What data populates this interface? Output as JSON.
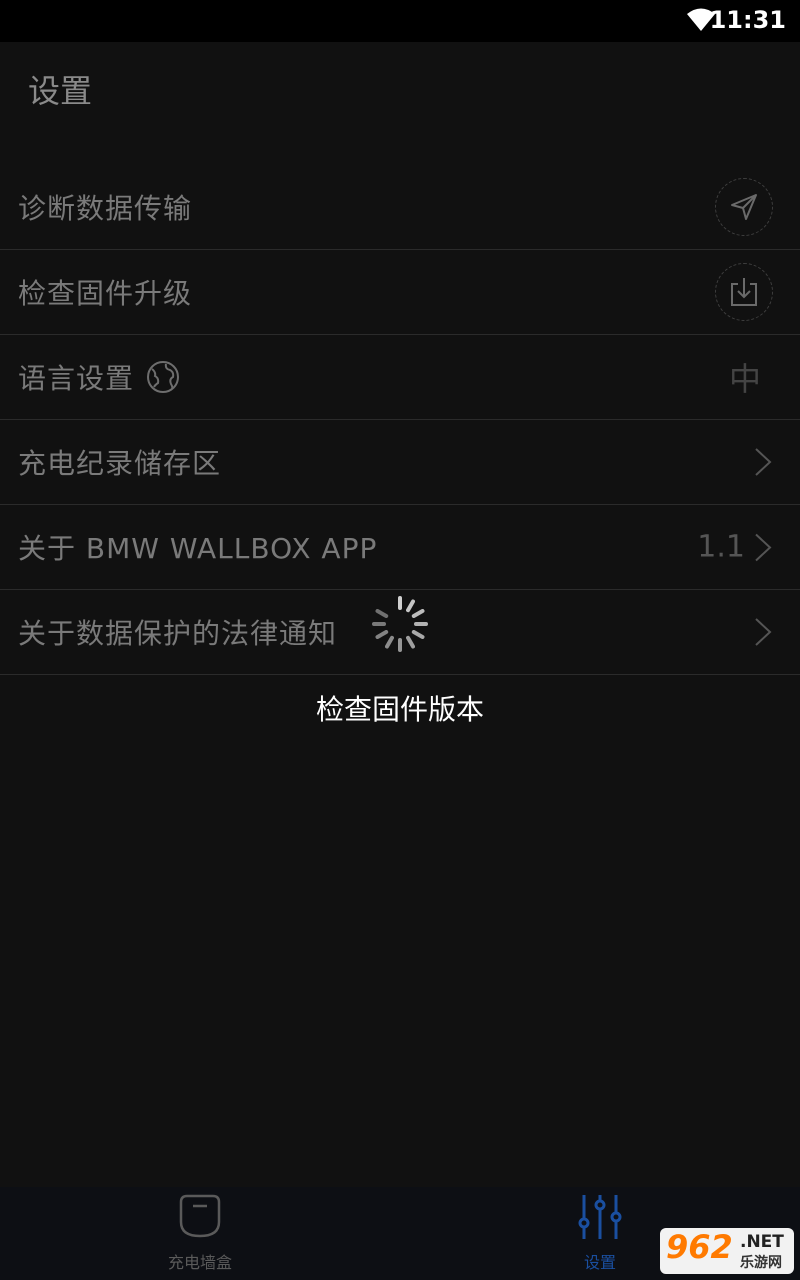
{
  "status_bar": {
    "time": "11:31"
  },
  "header": {
    "title": "设置"
  },
  "menu": {
    "items": [
      {
        "label": "诊断数据传输",
        "icon": "send-icon"
      },
      {
        "label": "检查固件升级",
        "icon": "download-icon"
      },
      {
        "label": "语言设置",
        "icon": "globe-icon",
        "value": "中"
      },
      {
        "label": "充电纪录储存区",
        "icon": "chevron-right-icon"
      },
      {
        "label": "关于 BMW WALLBOX APP",
        "icon": "chevron-right-icon",
        "value": "1.1"
      },
      {
        "label": "关于数据保护的法律通知",
        "icon": "chevron-right-icon"
      }
    ]
  },
  "loading": {
    "text": "检查固件版本"
  },
  "bottom_nav": {
    "items": [
      {
        "label": "充电墙盒",
        "icon": "wallbox-icon",
        "active": false
      },
      {
        "label": "设置",
        "icon": "sliders-icon",
        "active": true
      }
    ],
    "active_color": "#1a4fa0",
    "inactive_color": "#5a5a5a"
  },
  "watermark": {
    "number": "962",
    "net": ".NET",
    "site": "乐游网"
  }
}
